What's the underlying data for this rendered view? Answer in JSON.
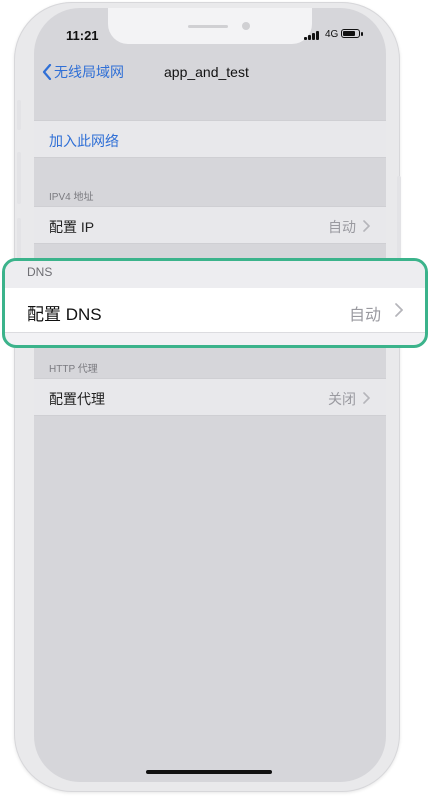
{
  "status": {
    "time": "11:21",
    "network": "4G"
  },
  "nav": {
    "back_label": "无线局域网",
    "title": "app_and_test"
  },
  "join_network": "加入此网络",
  "ipv4": {
    "header": "IPV4 地址",
    "label": "配置 IP",
    "value": "自动"
  },
  "dns": {
    "header": "DNS",
    "label": "配置 DNS",
    "value": "自动"
  },
  "proxy": {
    "header": "HTTP 代理",
    "label": "配置代理",
    "value": "关闭"
  },
  "colors": {
    "accent": "#2f6fd6",
    "highlight_border": "#3bb38b"
  }
}
